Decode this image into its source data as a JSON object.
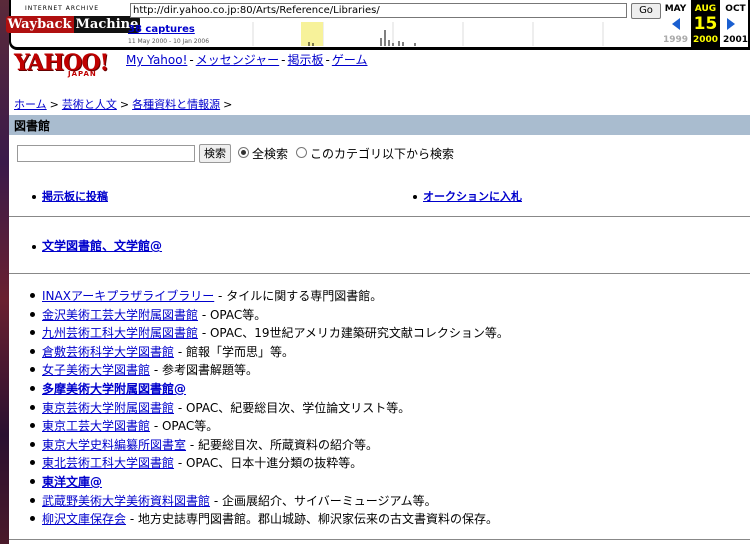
{
  "wayback": {
    "logo_top": "INTERNET ARCHIVE",
    "logo_main_1": "Wayback",
    "logo_main_2": "Machine",
    "url": "http://dir.yahoo.co.jp:80/Arts/Reference/Libraries/",
    "go_label": "Go",
    "captures": "38 captures",
    "date_range": "11 May 2000 - 10 Jan 2006",
    "prev_month": "MAY",
    "cur_month": "AUG",
    "next_month": "OCT",
    "day": "15",
    "prev_year": "1999",
    "cur_year": "2000",
    "next_year": "2001",
    "accent": "#1a5fd0"
  },
  "header": {
    "logo_text": "YAHOO!",
    "logo_sub": "JAPAN",
    "nav": [
      "My Yahoo!",
      "メッセンジャー",
      "掲示板",
      "ゲーム"
    ],
    "nav_sep": "-"
  },
  "breadcrumb": {
    "items": [
      "ホーム",
      "芸術と人文",
      "各種資料と情報源"
    ],
    "sep": ">"
  },
  "page": {
    "title": "図書館",
    "title_bar_color": "#a9bccf"
  },
  "search": {
    "input_value": "",
    "button_label": "検索",
    "option_all": "全検索",
    "option_category": "このカテゴリ以下から検索"
  },
  "side_links": {
    "bbs": "掲示板に投稿",
    "auction": "オークションに入札"
  },
  "featured": {
    "label": "文学図書館、文学館@"
  },
  "libraries": [
    {
      "name": "INAXアーキプラザライブラリー",
      "desc": " - タイルに関する専門図書館。",
      "bold": false
    },
    {
      "name": "金沢美術工芸大学附属図書館",
      "desc": " - OPAC等。",
      "bold": false
    },
    {
      "name": "九州芸術工科大学附属図書館",
      "desc": " - OPAC、19世紀アメリカ建築研究文献コレクション等。",
      "bold": false
    },
    {
      "name": "倉敷芸術科学大学図書館",
      "desc": " - 館報「学而思」等。",
      "bold": false
    },
    {
      "name": "女子美術大学図書館",
      "desc": " - 参考図書解題等。",
      "bold": false
    },
    {
      "name": "多摩美術大学附属図書館@",
      "desc": "",
      "bold": true
    },
    {
      "name": "東京芸術大学附属図書館",
      "desc": " - OPAC、紀要総目次、学位論文リスト等。",
      "bold": false
    },
    {
      "name": "東京工芸大学図書館",
      "desc": " - OPAC等。",
      "bold": false
    },
    {
      "name": "東京大学史料編纂所図書室",
      "desc": " - 紀要総目次、所蔵資料の紹介等。",
      "bold": false
    },
    {
      "name": "東北芸術工科大学図書館",
      "desc": " - OPAC、日本十進分類の抜粋等。",
      "bold": false
    },
    {
      "name": "東洋文庫@",
      "desc": "",
      "bold": true
    },
    {
      "name": "武蔵野美術大学美術資料図書館",
      "desc": " - 企画展紹介、サイバーミュージアム等。",
      "bold": false
    },
    {
      "name": "柳沢文庫保存会",
      "desc": " - 地方史誌専門図書館。郡山城跡、柳沢家伝来の古文書資料の保存。",
      "bold": false
    }
  ]
}
